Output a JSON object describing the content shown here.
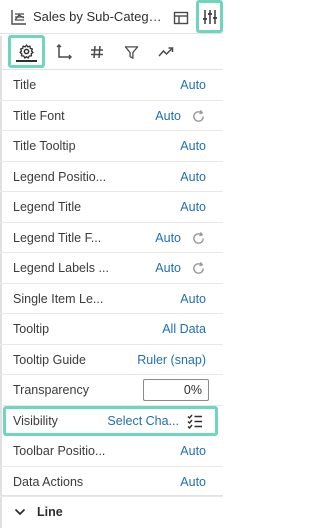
{
  "header": {
    "title": "Sales by Sub-Category"
  },
  "properties": [
    {
      "label": "Title",
      "value": "Auto"
    },
    {
      "label": "Title Font",
      "value": "Auto",
      "reset": true
    },
    {
      "label": "Title Tooltip",
      "value": "Auto"
    },
    {
      "label": "Legend Positio...",
      "value": "Auto"
    },
    {
      "label": "Legend Title",
      "value": "Auto"
    },
    {
      "label": "Legend Title F...",
      "value": "Auto",
      "reset": true
    },
    {
      "label": "Legend Labels ...",
      "value": "Auto",
      "reset": true
    },
    {
      "label": "Single Item Le...",
      "value": "Auto"
    },
    {
      "label": "Tooltip",
      "value": "All Data"
    },
    {
      "label": "Tooltip Guide",
      "value": "Ruler (snap)"
    },
    {
      "label": "Transparency",
      "value": "0%"
    },
    {
      "label": "Visibility",
      "value": "Select Cha..."
    },
    {
      "label": "Toolbar Positio...",
      "value": "Auto"
    },
    {
      "label": "Data Actions",
      "value": "Auto"
    }
  ],
  "section": {
    "label": "Line"
  },
  "colors": {
    "highlight": "#6fd6be",
    "link": "#1f6fb2"
  }
}
